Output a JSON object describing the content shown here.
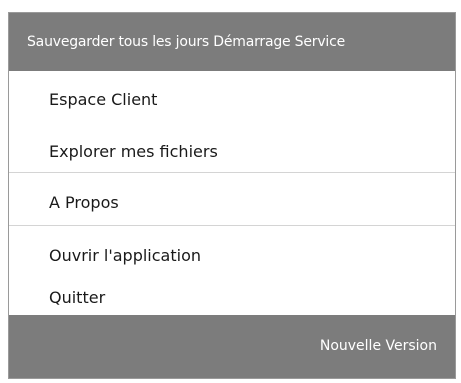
{
  "menu": {
    "header_text": "Sauvegarder tous les jours Démarrage Service",
    "items": [
      {
        "label": "Espace Client"
      },
      {
        "label": "Explorer mes fichiers"
      },
      {
        "label": "A Propos"
      },
      {
        "label": "Ouvrir l'application"
      },
      {
        "label": "Quitter"
      }
    ],
    "footer_text": "Nouvelle Version"
  },
  "colors": {
    "header_bg": "#7c7c7c",
    "footer_bg": "#7c7c7c",
    "separator": "#d4d4d4",
    "text": "#1a1a1a"
  }
}
